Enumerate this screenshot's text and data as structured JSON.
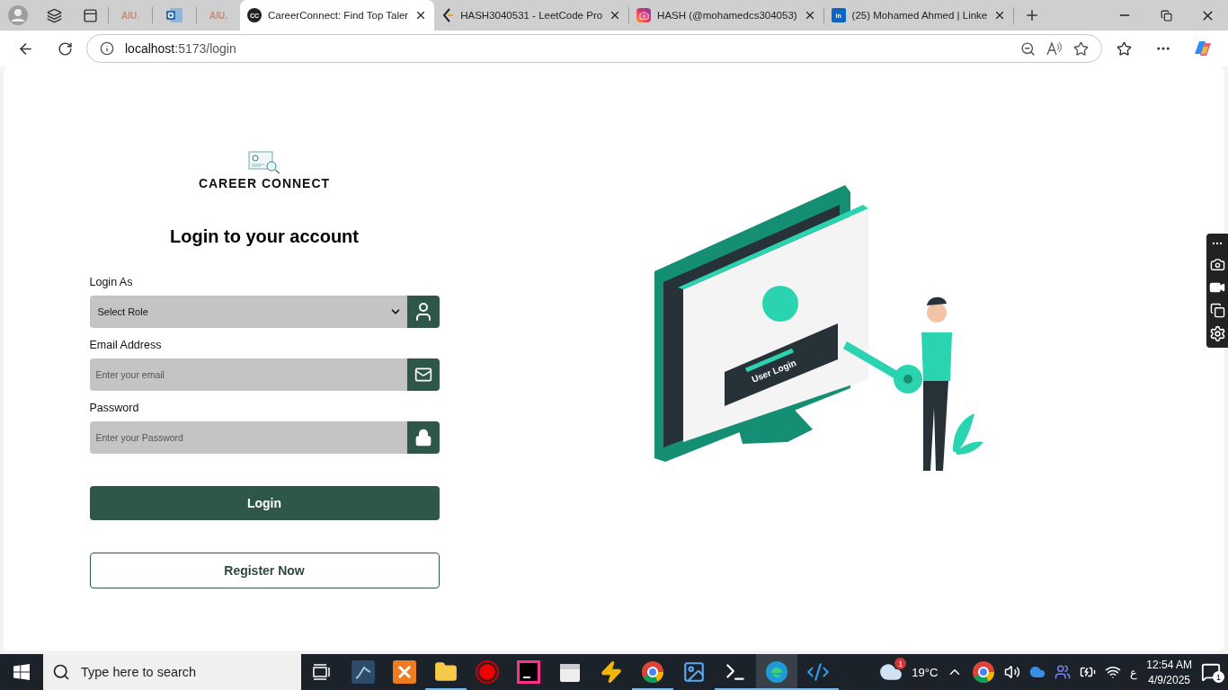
{
  "browser": {
    "pinned_tabs": [
      {
        "label": "AIU.",
        "kind": "text"
      },
      {
        "kind": "outlook"
      },
      {
        "label": "AIU.",
        "kind": "text"
      }
    ],
    "tabs": [
      {
        "title": "CareerConnect: Find Top Taler",
        "kind": "cc",
        "favicon_text": "CC",
        "selected": true
      },
      {
        "title": "HASH3040531 - LeetCode Pro",
        "kind": "leetcode",
        "selected": false
      },
      {
        "title": "HASH (@mohamedcs304053)",
        "kind": "instagram",
        "selected": false
      },
      {
        "title": "(25) Mohamed Ahmed | Linke",
        "kind": "linkedin",
        "favicon_text": "in",
        "selected": false
      }
    ],
    "address": {
      "host": "localhost",
      "rest": ":5173/login"
    }
  },
  "page": {
    "logo_text": "CAREER CONNECT",
    "heading": "Login to your account",
    "fields": [
      {
        "label": "Login As",
        "kind": "select",
        "value": "Select Role"
      },
      {
        "label": "Email Address",
        "kind": "email",
        "placeholder": "Enter your email"
      },
      {
        "label": "Password",
        "kind": "password",
        "placeholder": "Enter your Password"
      }
    ],
    "login_button": "Login",
    "register_button": "Register Now",
    "illustration_text": "User Login"
  },
  "taskbar": {
    "search_placeholder": "Type here to search",
    "apps": [
      {
        "kind": "mysql",
        "running": false,
        "selected": false
      },
      {
        "kind": "xampp",
        "running": false,
        "selected": false
      },
      {
        "kind": "folder",
        "running": true,
        "selected": false
      },
      {
        "kind": "record",
        "running": false,
        "selected": false
      },
      {
        "kind": "intellij",
        "running": false,
        "selected": false
      },
      {
        "kind": "player",
        "running": false,
        "selected": false
      },
      {
        "kind": "bolt",
        "running": false,
        "selected": false
      },
      {
        "kind": "chrome",
        "running": true,
        "selected": false
      },
      {
        "kind": "photos",
        "running": false,
        "selected": false
      },
      {
        "kind": "terminal",
        "running": true,
        "selected": false
      },
      {
        "kind": "edge",
        "running": true,
        "selected": true
      },
      {
        "kind": "vscode",
        "running": true,
        "selected": false
      }
    ],
    "weather_badge": "1",
    "temperature": "19°C",
    "keyboard": "ع",
    "time": "12:54 AM",
    "date": "4/9/2025",
    "notification_count": "1"
  }
}
